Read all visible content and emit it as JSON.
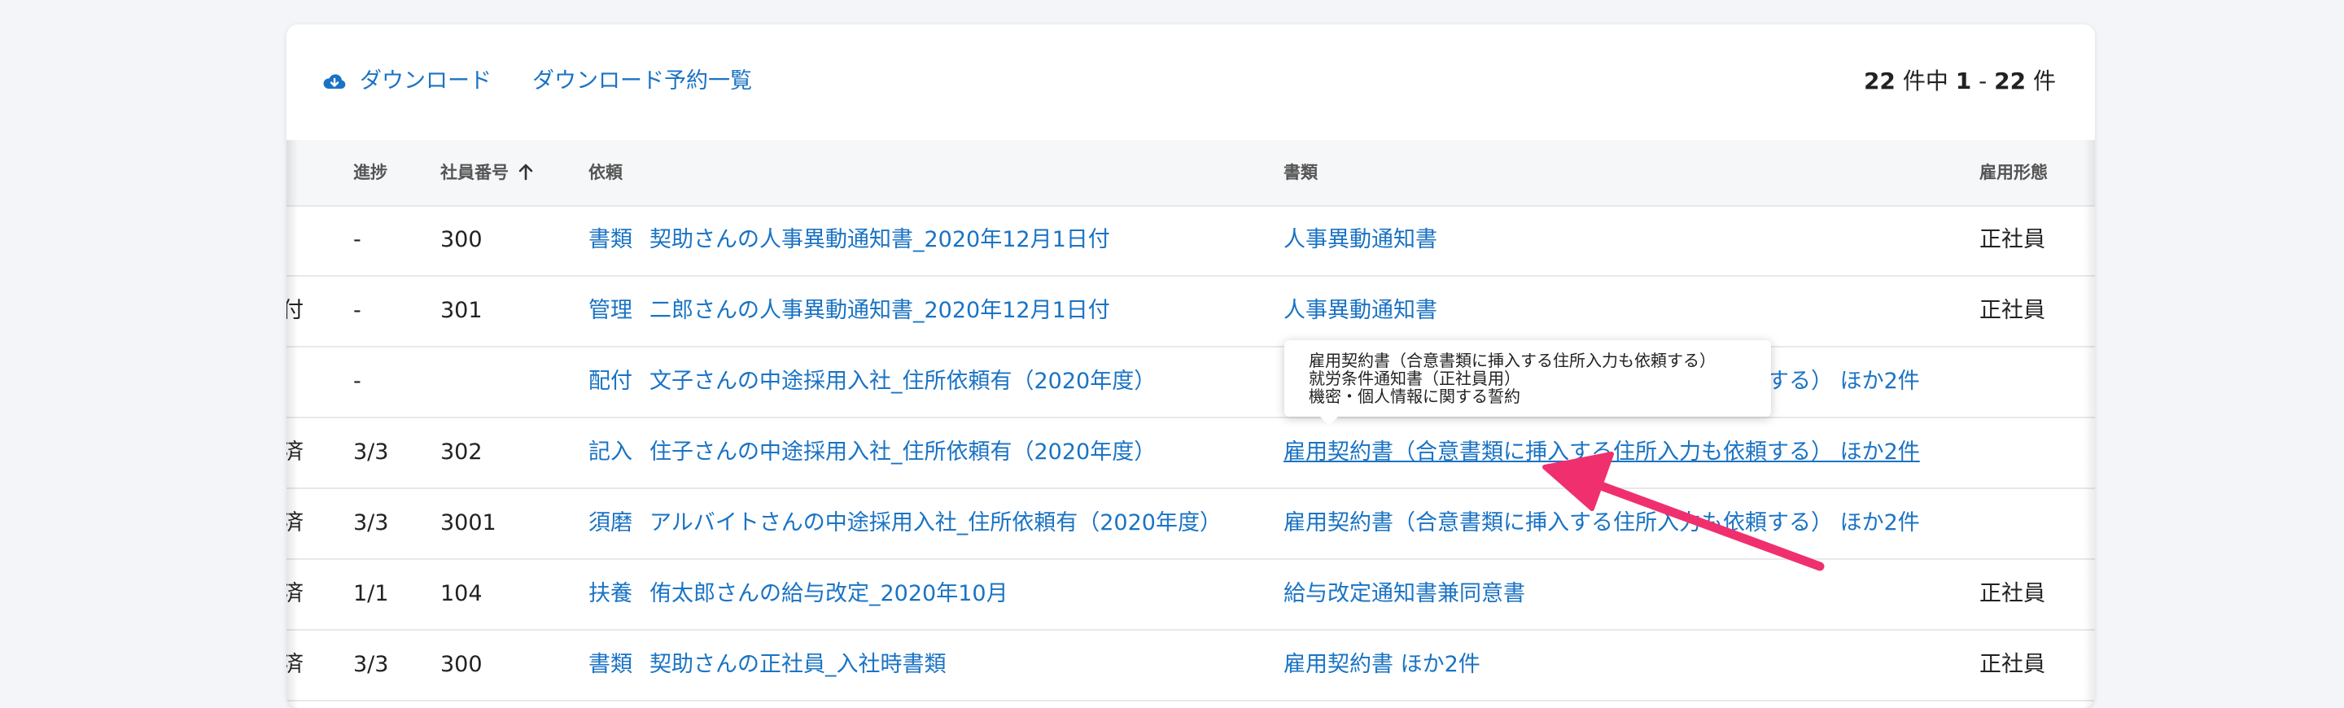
{
  "toolbar": {
    "download_label": "ダウンロード",
    "download_list_label": "ダウンロード予約一覧",
    "count": {
      "total": "22",
      "mid1": " 件中 ",
      "from": "1",
      "dash": " - ",
      "to": "22",
      "suffix": " 件"
    }
  },
  "columns": {
    "progress": "進捗",
    "employee_no": "社員番号",
    "request": "依頼",
    "documents": "書類",
    "employment_type": "雇用形態"
  },
  "rows": [
    {
      "edge": "",
      "progress": "-",
      "employee_no": "300",
      "request_tag": "書類",
      "request": "契助さんの人事異動通知書_2020年12月1日付",
      "documents": "人事異動通知書",
      "employment_type": "正社員"
    },
    {
      "edge": "付",
      "progress": "-",
      "employee_no": "301",
      "request_tag": "管理",
      "request": "二郎さんの人事異動通知書_2020年12月1日付",
      "documents": "人事異動通知書",
      "employment_type": "正社員"
    },
    {
      "edge": "",
      "progress": "-",
      "employee_no": "",
      "request_tag": "配付",
      "request": "文子さんの中途採用入社_住所依頼有（2020年度）",
      "documents": "雇用契約書（合意書類に挿入する住所入力も依頼する） ほか2件",
      "employment_type": ""
    },
    {
      "edge": "済",
      "progress": "3/3",
      "employee_no": "302",
      "request_tag": "記入",
      "request": "住子さんの中途採用入社_住所依頼有（2020年度）",
      "documents": "雇用契約書（合意書類に挿入する住所入力も依頼する） ほか2件",
      "employment_type": ""
    },
    {
      "edge": "済",
      "progress": "3/3",
      "employee_no": "3001",
      "request_tag": "須磨",
      "request": "アルバイトさんの中途採用入社_住所依頼有（2020年度）",
      "documents": "雇用契約書（合意書類に挿入する住所入力も依頼する） ほか2件",
      "employment_type": ""
    },
    {
      "edge": "済",
      "progress": "1/1",
      "employee_no": "104",
      "request_tag": "扶養",
      "request": "侑太郎さんの給与改定_2020年10月",
      "documents": "給与改定通知書兼同意書",
      "employment_type": "正社員"
    },
    {
      "edge": "済",
      "progress": "3/3",
      "employee_no": "300",
      "request_tag": "書類",
      "request": "契助さんの正社員_入社時書類",
      "documents": "雇用契約書 ほか2件",
      "employment_type": "正社員"
    }
  ],
  "tooltip": {
    "lines": [
      "雇用契約書（合意書類に挿入する住所入力も依頼する）",
      "就労条件通知書（正社員用）",
      "機密・個人情報に関する誓約"
    ]
  },
  "colors": {
    "link": "#1a73c4",
    "annotation_arrow": "#f0306e"
  },
  "icons": {
    "download": "cloud-download-icon",
    "sort": "arrow-up-icon"
  }
}
